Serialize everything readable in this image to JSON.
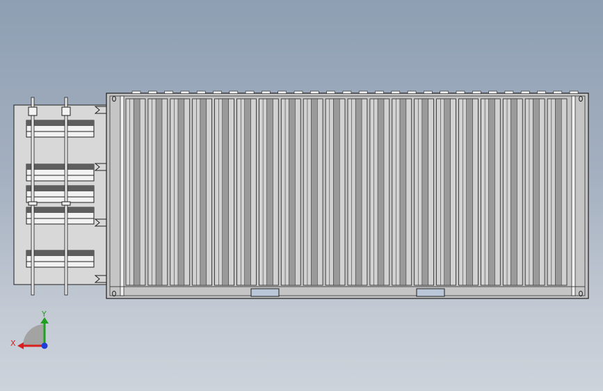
{
  "triad": {
    "x_label": "X",
    "y_label": "Y",
    "x_color": "#d81e1e",
    "y_color": "#1ea01e",
    "z_color": "#1e3cd8"
  },
  "colors": {
    "container_fill": "#c5c5c5",
    "panel_fill": "#d8d8d8",
    "panel_bar": "#f2f2f2",
    "panel_bar_dark": "#5e5e5e",
    "outline": "#1e1e1e",
    "rod": "#e4e4e4",
    "bottom_slot": "#b9c7d8"
  },
  "container": {
    "corrugation_count": 20
  },
  "side_panel": {
    "shelf_count": 5
  }
}
